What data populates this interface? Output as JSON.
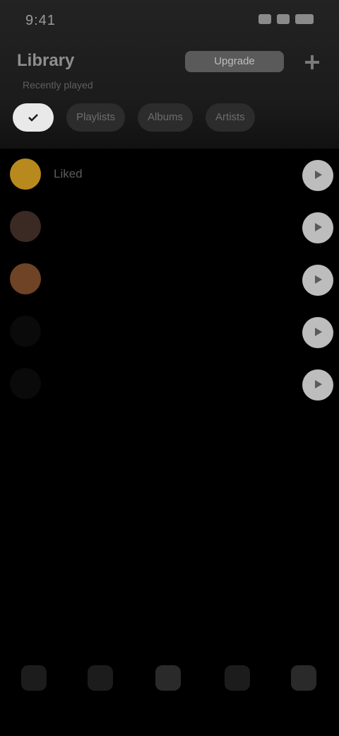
{
  "status_bar": {
    "time": "9:41"
  },
  "header": {
    "title": "Library",
    "action_label": "Upgrade",
    "action_icon": "plus-icon",
    "subtitle": "Recently played"
  },
  "filters": {
    "active_icon": "check-icon",
    "tabs": [
      "Playlists",
      "Albums",
      "Artists"
    ]
  },
  "list": {
    "items": [
      {
        "title": "Liked",
        "avatar_color": "#b8891c",
        "action_icon": "play-icon"
      },
      {
        "title": "",
        "avatar_color": "#3b2a24",
        "action_icon": "play-icon"
      },
      {
        "title": "",
        "avatar_color": "#6e4326",
        "action_icon": "play-icon"
      },
      {
        "title": "",
        "avatar_color": "#0a0a0a",
        "action_icon": "play-icon"
      },
      {
        "title": "",
        "avatar_color": "#0a0a0a",
        "action_icon": "play-icon"
      }
    ]
  },
  "bottom_nav": {
    "items": [
      {
        "label": "",
        "icon": "home-icon"
      },
      {
        "label": "",
        "icon": "search-icon"
      },
      {
        "label": "",
        "icon": "library-icon"
      },
      {
        "label": "",
        "icon": "radio-icon"
      },
      {
        "label": "",
        "icon": "profile-icon"
      }
    ]
  },
  "colors": {
    "background": "#000000",
    "header_background": "#1f1f1f",
    "accent": "#e9e9e9",
    "liked_gold": "#b8891c"
  }
}
